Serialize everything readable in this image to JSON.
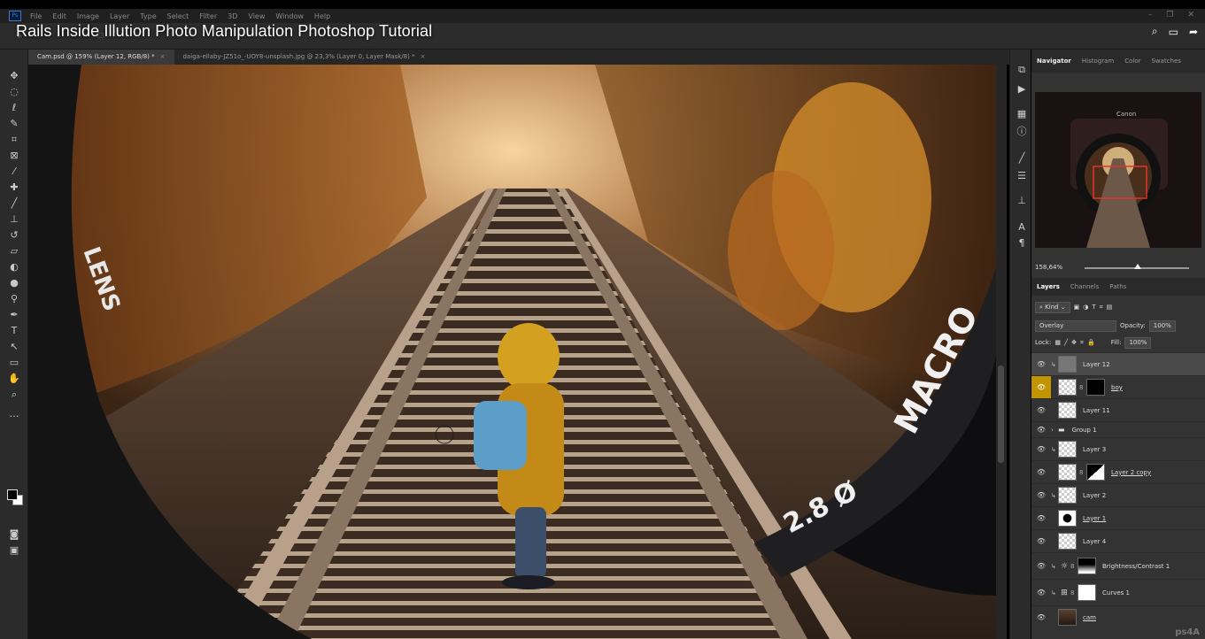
{
  "video": {
    "title": "Rails Inside Illution Photo Manipulation Photoshop Tutorial"
  },
  "menubar": {
    "items": [
      "File",
      "Edit",
      "Image",
      "Layer",
      "Type",
      "Select",
      "Filter",
      "3D",
      "View",
      "Window",
      "Help"
    ]
  },
  "tabs": [
    {
      "label": "Cam.psd @ 159% (Layer 12, RGB/8) *",
      "active": true
    },
    {
      "label": "daiga-ellaby-JZ51o_-UOY8-unsplash.jpg @ 23,3% (Layer 0, Layer Mask/8) *",
      "active": false
    }
  ],
  "canvas": {
    "lens_text_left": "LENS",
    "lens_text_right": "MACRO",
    "lens_number": "2.8 Ø"
  },
  "panel": {
    "top_tabs": [
      "Navigator",
      "Histogram",
      "Color",
      "Swatches"
    ],
    "navigator": {
      "zoom": "158,64%",
      "camera_brand": "Canon"
    },
    "layer_tabs": [
      "Layers",
      "Channels",
      "Paths"
    ],
    "kind_label": "Kind",
    "blend_mode": "Overlay",
    "opacity_label": "Opacity:",
    "opacity_value": "100%",
    "lock_label": "Lock:",
    "fill_label": "Fill:",
    "fill_value": "100%",
    "layers": [
      {
        "name": "Layer 12",
        "selected": true
      },
      {
        "name": "boy"
      },
      {
        "name": "Layer 11"
      },
      {
        "name": "Group 1"
      },
      {
        "name": "Layer 3"
      },
      {
        "name": "Layer 2 copy"
      },
      {
        "name": "Layer 2"
      },
      {
        "name": "Layer 1"
      },
      {
        "name": "Layer 4"
      },
      {
        "name": "Brightness/Contrast 1"
      },
      {
        "name": "Curves 1"
      },
      {
        "name": "cam"
      }
    ],
    "corner_logo": "ps4A"
  },
  "colors": {
    "accent_eye": "#c29400",
    "nav_box": "#e0332a"
  }
}
